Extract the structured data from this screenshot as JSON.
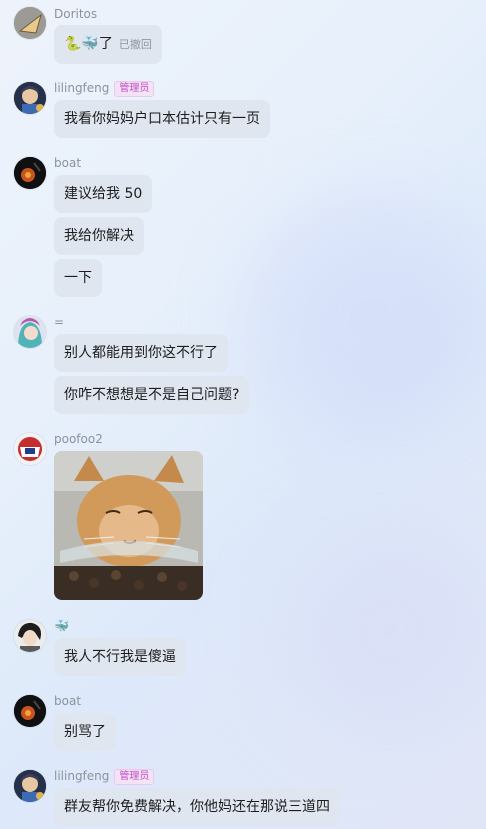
{
  "messages": [
    {
      "sender": "Doritos",
      "badge": "",
      "text": "🐍🐳了",
      "recall_note": "已撤回"
    },
    {
      "sender": "lilingfeng",
      "badge": "管理员",
      "text": "我看你妈妈户口本估计只有一页"
    },
    {
      "sender": "boat",
      "badge": "",
      "texts": [
        "建议给我 50",
        "我给你解决",
        "一下"
      ]
    },
    {
      "sender": "=",
      "badge": "",
      "texts": [
        "别人都能用到你这不行了",
        "你咋不想想是不是自己问题?"
      ]
    },
    {
      "sender": "poofoo2",
      "badge": "",
      "image": "cat-meme"
    },
    {
      "sender": "🐳",
      "badge": "",
      "text": "我人不行我是傻逼"
    },
    {
      "sender": "boat",
      "badge": "",
      "text": "别骂了"
    },
    {
      "sender": "lilingfeng",
      "badge": "管理员",
      "text": "群友帮你免费解决，你他妈还在那说三道四"
    }
  ],
  "colors": {
    "bubble": "#dfe6ef",
    "admin_badge": "#c04fc4",
    "sender_name": "#8c929c"
  }
}
